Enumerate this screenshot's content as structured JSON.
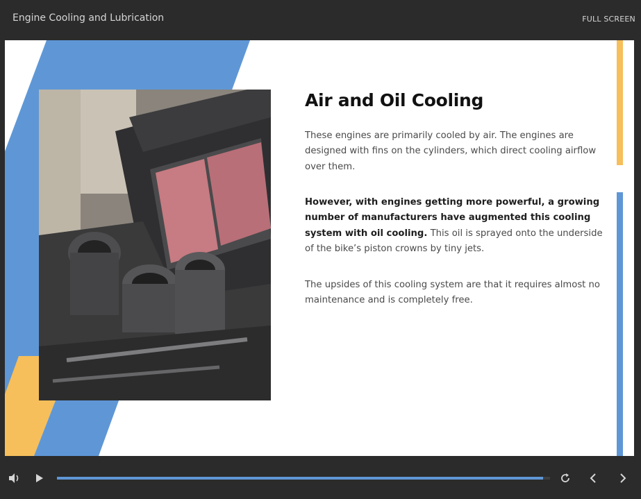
{
  "header": {
    "title": "Engine Cooling and Lubrication",
    "fullscreen_label": "FULL SCREEN"
  },
  "slide": {
    "heading": "Air and Oil Cooling",
    "paragraph1": "These engines are primarily cooled by air. The engines are designed with fins on the cylinders, which direct cooling airflow over them.",
    "paragraph2_bold": "However, with engines getting more powerful, a growing number of manufacturers have augmented this cooling system with oil cooling.",
    "paragraph2_rest": " This oil is sprayed onto the underside of the bike’s piston crowns by tiny jets.",
    "paragraph3": "The upsides of this cooling system are that it requires almost no maintenance and is completely free.",
    "image_subject": "motorcycle engine with air filter and intake manifold"
  },
  "player": {
    "progress_fraction": 0.986,
    "icons": [
      "volume-icon",
      "play-icon",
      "replay-icon",
      "chevron-left-icon",
      "chevron-right-icon"
    ]
  },
  "colors": {
    "accent_blue": "#5f97d6",
    "accent_yellow": "#f6bf5b",
    "chrome_dark": "#2b2b2b"
  }
}
